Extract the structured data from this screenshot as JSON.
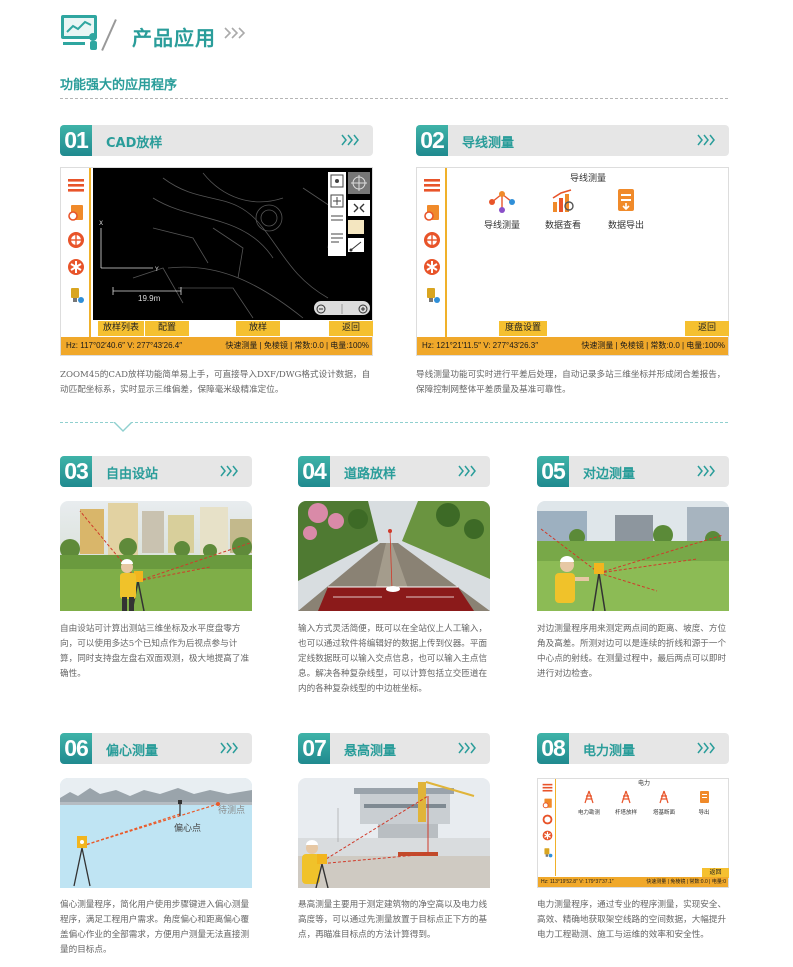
{
  "header": {
    "title": "产品应用",
    "subtitle": "功能强大的应用程序"
  },
  "colors": {
    "accent": "#2a9d9a",
    "status": "#f0a82a",
    "button": "#f5c030"
  },
  "sections": [
    {
      "num": "01",
      "name": "CAD放样",
      "screen": {
        "scale": "19.9m",
        "buttons": [
          "放样列表",
          "配置",
          "放样",
          "返回"
        ],
        "status_left": "Hz: 117°02′40.6″  V: 277°43′26.4″",
        "status_right": "快速测量 | 免棱镜 | 常数:0.0 | 电量:100%"
      },
      "desc": "ZOOM45的CAD放样功能简单易上手，可直接导入DXF/DWG格式设计数据，自动匹配坐标系，实时显示三维偏差，保障毫米级精准定位。"
    },
    {
      "num": "02",
      "name": "导线测量",
      "screen": {
        "title": "导线测量",
        "apps": [
          "导线测量",
          "数据查看",
          "数据导出"
        ],
        "buttons": [
          "度盘设置",
          "返回"
        ],
        "status_left": "Hz: 121°21′11.5″  V: 277°43′26.3″",
        "status_right": "快速测量 | 免棱镜 | 常数:0.0 | 电量:100%"
      },
      "desc": "导线测量功能可实时进行平差后处理，自动记录多站三维坐标并形成闭合差报告，保障控制网整体平差质量及基准可靠性。"
    },
    {
      "num": "03",
      "name": "自由设站",
      "desc": "自由设站可计算出测站三维坐标及水平度盘零方向，可以使用多达5个已知点作为后视点参与计算，同时支持盘左盘右双面观测，极大地提高了准确性。"
    },
    {
      "num": "04",
      "name": "道路放样",
      "desc": "输入方式灵活简便，既可以在全站仪上人工输入，也可以通过软件将编辑好的数据上传到仪器。平面定线数据既可以输入交点信息，也可以输入主点信息。解决各种复杂线型，可以计算包括立交匝道在内的各种复杂线型的中边桩坐标。"
    },
    {
      "num": "05",
      "name": "对边测量",
      "desc": "对边测量程序用来测定两点间的距离、坡度、方位角及高差。所测对边可以是连续的折线和源于一个中心点的射线。在测量过程中，最后两点可以即时进行对边检查。"
    },
    {
      "num": "06",
      "name": "偏心测量",
      "labels": [
        "待测点",
        "偏心点"
      ],
      "desc": "偏心测量程序，简化用户使用步骤键进入偏心测量程序，满足工程用户需求。角度偏心和距离偏心覆盖偏心作业的全部需求，方便用户测量无法直接测量的目标点。"
    },
    {
      "num": "07",
      "name": "悬高测量",
      "desc": "悬高测量主要用于测定建筑物的净空高以及电力线高度等，可以通过先测量放置于目标点正下方的基点，再瞄准目标点的方法计算得到。"
    },
    {
      "num": "08",
      "name": "电力测量",
      "screen": {
        "title": "电力",
        "apps": [
          "电力勘测",
          "杆塔放样",
          "塔基断面",
          "导出"
        ],
        "buttons": [
          "返回"
        ],
        "status_left": "Hz: 113°19′52.8″  V: 179°37′37.1″",
        "status_right": "快速测量 | 免棱镜 | 常数:0.0 | 电量:0"
      },
      "desc": "电力测量程序，通过专业的程序测量，实现安全、高效、精确地获取架空线路的空间数据，大幅提升电力工程勘测、施工与运维的效率和安全性。"
    }
  ]
}
